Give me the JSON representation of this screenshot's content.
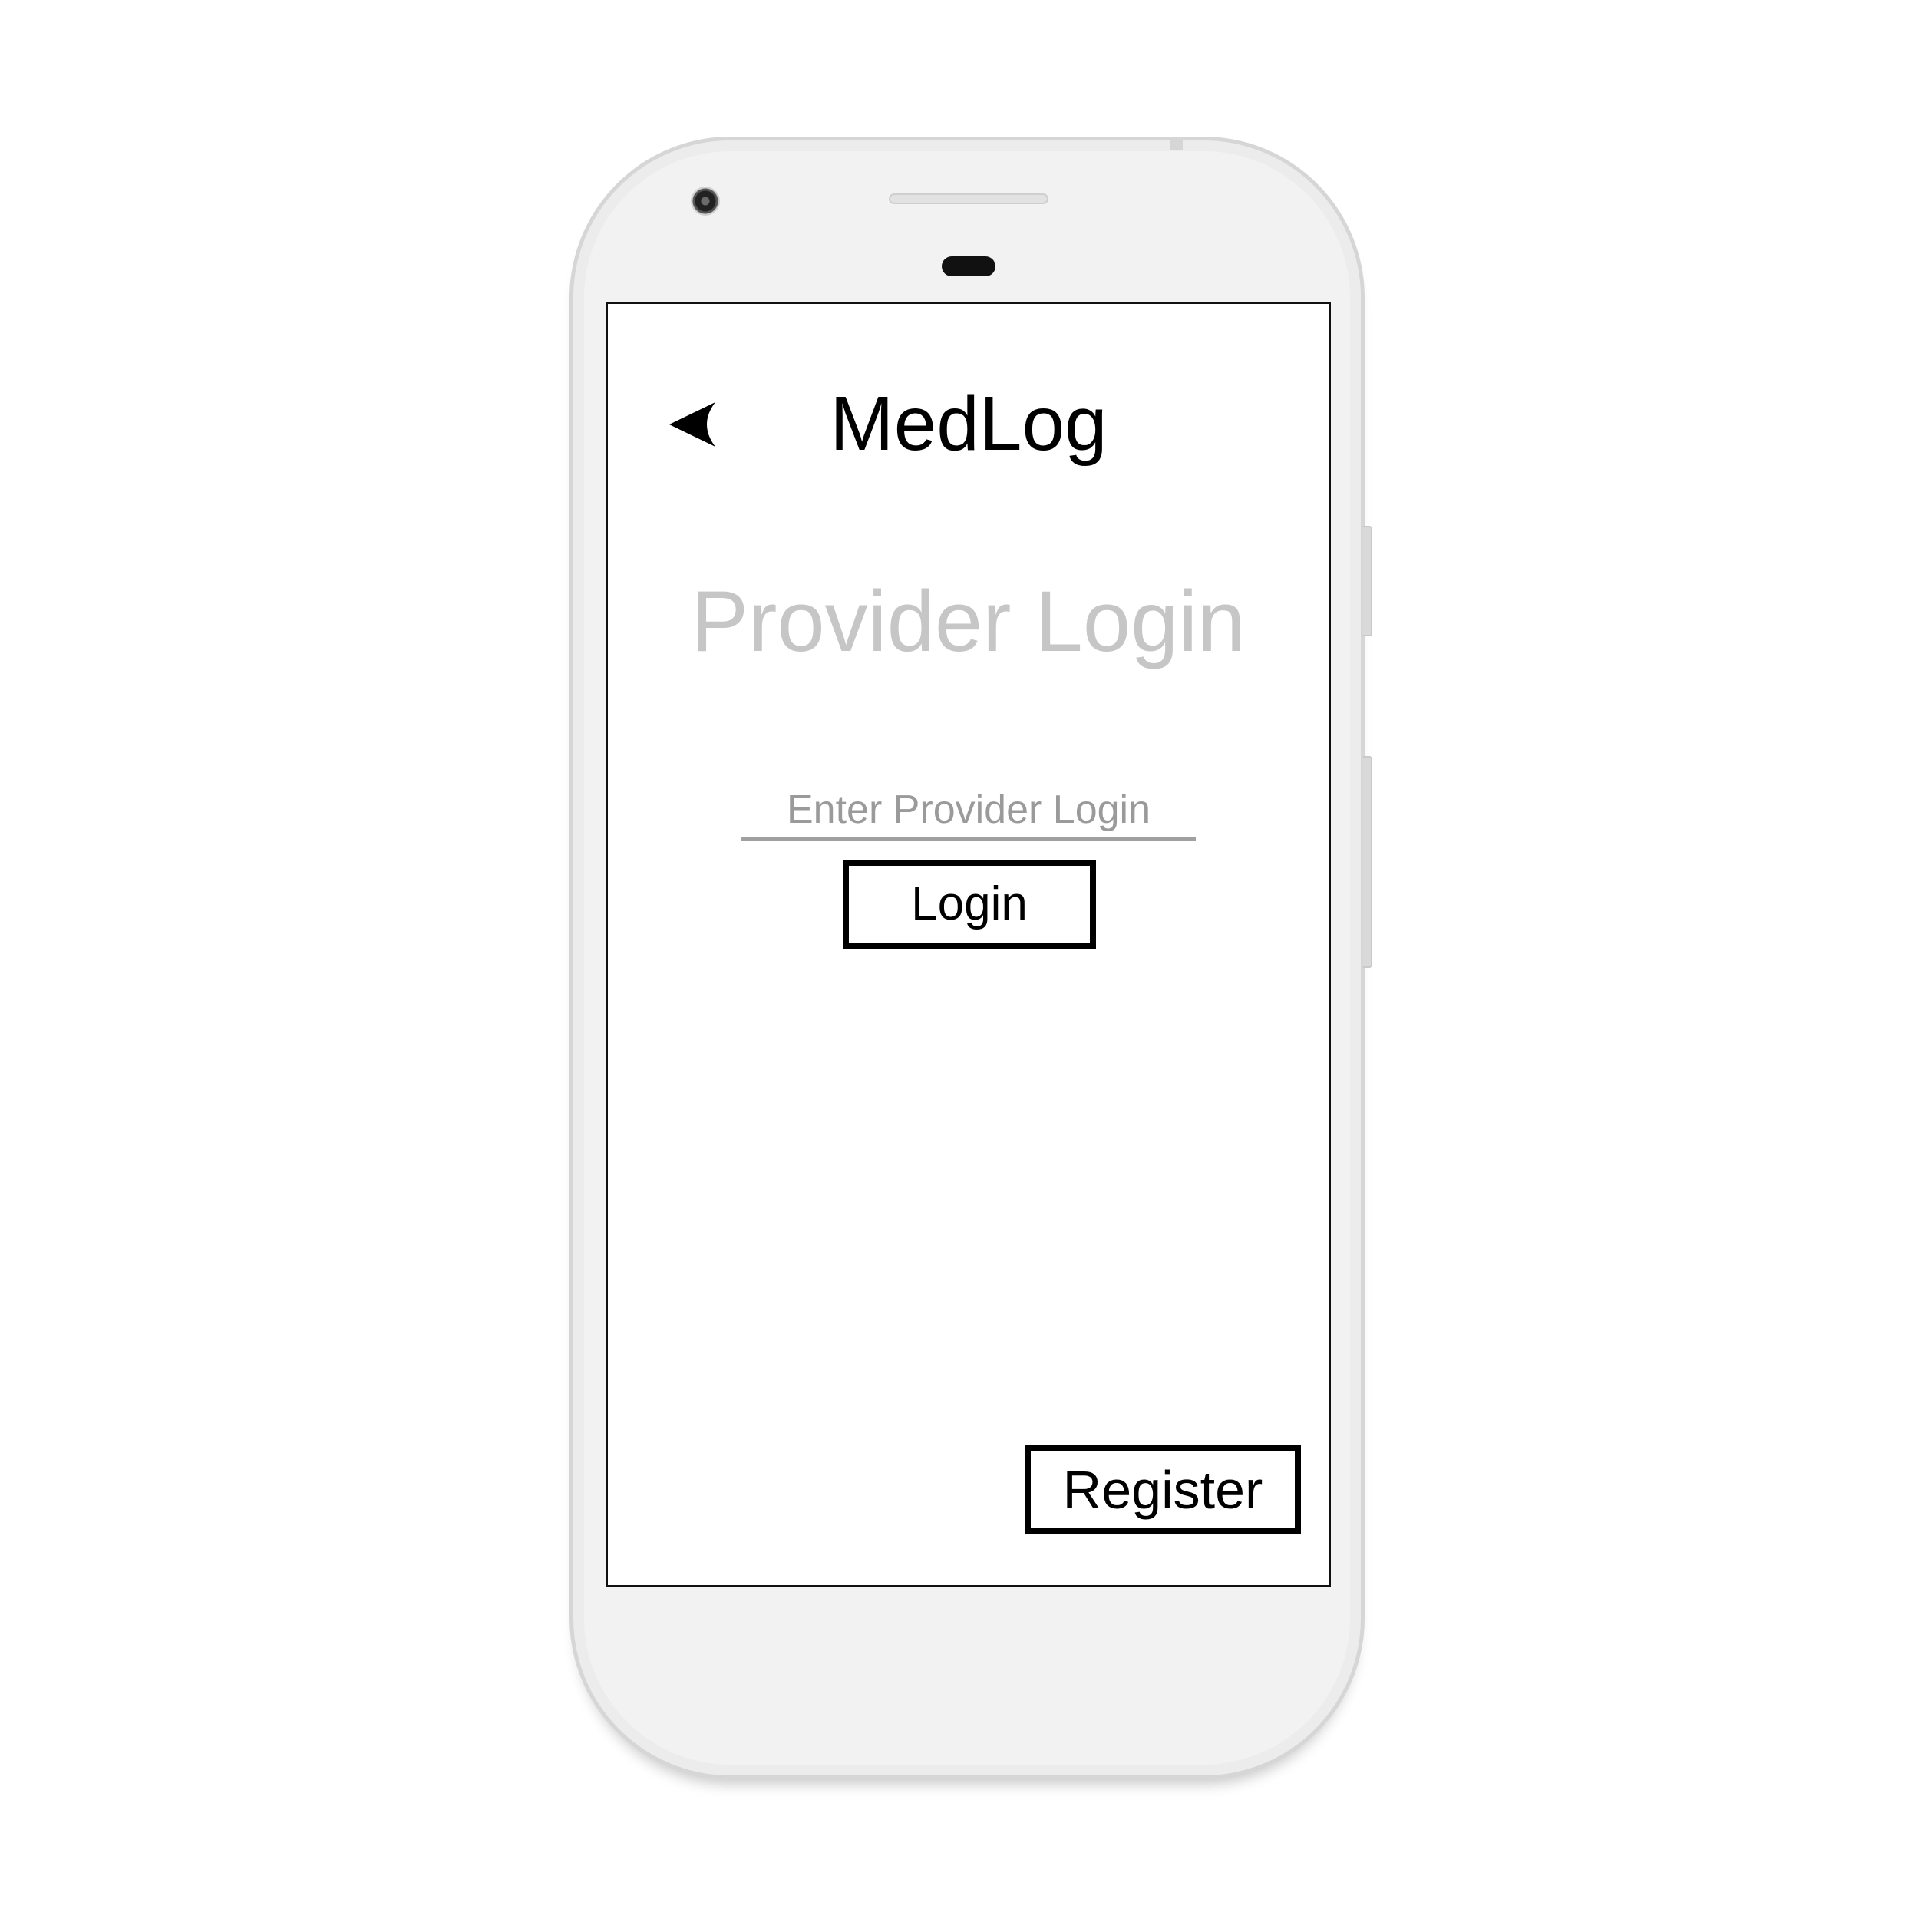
{
  "app": {
    "title": "MedLog"
  },
  "page": {
    "heading": "Provider Login"
  },
  "form": {
    "login_placeholder": "Enter Provider Login",
    "login_value": "",
    "login_button": "Login"
  },
  "footer": {
    "register_button": "Register"
  },
  "icons": {
    "back": "back-arrow-icon"
  },
  "colors": {
    "screen_background": "#ffffff",
    "heading_text": "#c6c6c6",
    "placeholder_text": "#9a9a9a",
    "input_underline": "#a0a0a0",
    "button_border": "#000000",
    "device_body": "#f2f2f2"
  }
}
